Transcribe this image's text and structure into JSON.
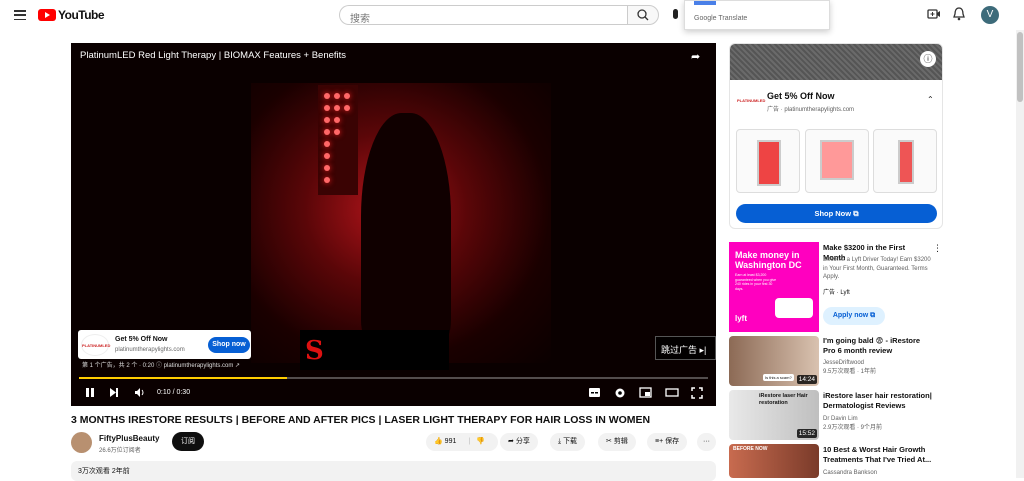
{
  "header": {
    "logo_text": "YouTube",
    "search_placeholder": "搜索",
    "translate_label": "Google Translate",
    "avatar_letter": "V"
  },
  "player": {
    "title": "PlatinumLED Red Light Therapy | BIOMAX Features + Benefits",
    "overlay_logo_letter": "S",
    "ad_card": {
      "logo_text": "PLATINUMLED",
      "headline": "Get 5% Off Now",
      "url": "platinumtherapylights.com",
      "button": "Shop now"
    },
    "ad_info": "第 1 个广告，共 2 个 · 0:20 ⓘ  platinumtherapylights.com ↗",
    "skip_label": "跳过广告",
    "time": "0:10 / 0:30",
    "progress": 0.33
  },
  "video": {
    "title": "3 MONTHS IRESTORE RESULTS | BEFORE AND AFTER PICS | LASER LIGHT THERAPY FOR HAIR LOSS IN WOMEN",
    "channel": "FiftyPlusBeauty",
    "subscribers": "26.6万位订阅者",
    "subscribe": "订阅",
    "likes": "991",
    "share": "分享",
    "download": "下载",
    "clip": "剪辑",
    "save": "保存",
    "more": "···",
    "stats": "3万次观看  2年前"
  },
  "sidebar_ad": {
    "logo_text": "PLATINUMLED",
    "headline": "Get 5% Off Now",
    "sponsor": "广告 · platinumtherapylights.com",
    "shop_button": "Shop Now"
  },
  "lyft_ad": {
    "thumb_text": "Make money in Washington DC",
    "thumb_small": "Earn at least $3,200 guaranteed when you give 240 rides in your first 30 days.",
    "logo": "lyft",
    "title": "Make $3200 in the First Month",
    "desc": "Become a Lyft Driver Today! Earn $3200 in Your First Month, Guaranteed. Terms Apply.",
    "sponsor": "广告 · Lyft",
    "apply": "Apply now"
  },
  "related": [
    {
      "title": "I'm going bald 😨 - iRestore Pro 6 month review",
      "channel": "JesseDriftwood",
      "meta": "9.5万次观看 · 1年前",
      "duration": "14:24",
      "thumb_text": "Is this a scam?"
    },
    {
      "title": "iRestore laser hair restoration| Dermatologist Reviews",
      "channel": "Dr Davin Lim",
      "meta": "2.9万次观看 · 9个月前",
      "duration": "15:52",
      "thumb_text": "iRestore laser Hair restoration"
    },
    {
      "title": "10 Best & Worst Hair Growth Treatments That I've Tried At...",
      "channel": "Cassandra Bankson",
      "meta": "",
      "duration": "",
      "thumb_text": "BEFORE  NOW"
    }
  ]
}
